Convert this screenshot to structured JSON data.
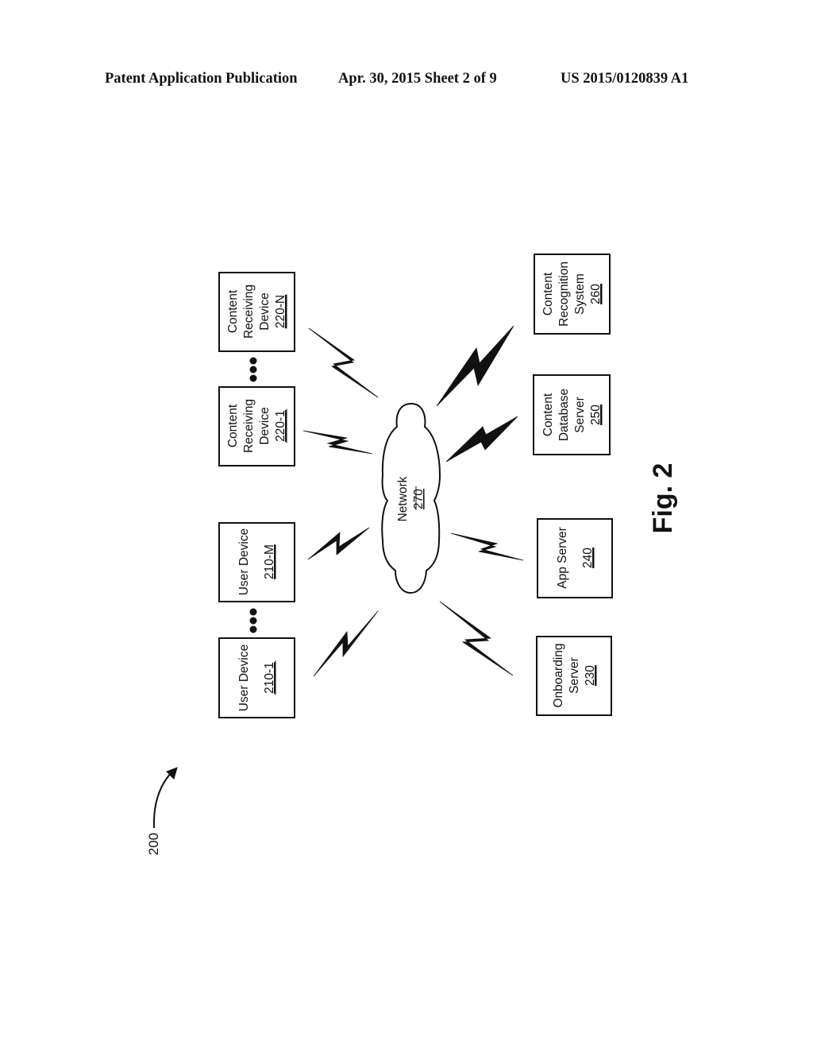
{
  "header": {
    "publication": "Patent Application Publication",
    "date_sheet": "Apr. 30, 2015  Sheet 2 of 9",
    "patent_number": "US 2015/0120839 A1"
  },
  "figure": {
    "label": "Fig. 2",
    "reference": "200",
    "orientation": "rotated 90° counter-clockwise"
  },
  "network": {
    "name": "Network",
    "ref": "270"
  },
  "nodes": {
    "user_device_1": {
      "lines": [
        "User Device"
      ],
      "ref": "210-1"
    },
    "user_device_m": {
      "lines": [
        "User Device"
      ],
      "ref": "210-M"
    },
    "content_receiving_1": {
      "lines": [
        "Content",
        "Receiving",
        "Device"
      ],
      "ref": "220-1"
    },
    "content_receiving_n": {
      "lines": [
        "Content",
        "Receiving",
        "Device"
      ],
      "ref": "220-N"
    },
    "onboarding_server": {
      "lines": [
        "Onboarding",
        "Server"
      ],
      "ref": "230"
    },
    "app_server": {
      "lines": [
        "App Server"
      ],
      "ref": "240"
    },
    "content_db_server": {
      "lines": [
        "Content",
        "Database",
        "Server"
      ],
      "ref": "250"
    },
    "content_recognition": {
      "lines": [
        "Content",
        "Recognition",
        "System"
      ],
      "ref": "260"
    }
  },
  "connections": [
    {
      "from": "user_device_1",
      "to": "network",
      "type": "wireless"
    },
    {
      "from": "user_device_m",
      "to": "network",
      "type": "wireless"
    },
    {
      "from": "content_receiving_1",
      "to": "network",
      "type": "wireless"
    },
    {
      "from": "content_receiving_n",
      "to": "network",
      "type": "wireless"
    },
    {
      "from": "onboarding_server",
      "to": "network",
      "type": "wireless"
    },
    {
      "from": "app_server",
      "to": "network",
      "type": "wireless"
    },
    {
      "from": "content_db_server",
      "to": "network",
      "type": "wireless"
    },
    {
      "from": "content_recognition",
      "to": "network",
      "type": "wireless"
    }
  ],
  "ellipses": [
    "between user devices",
    "between content receiving devices"
  ]
}
